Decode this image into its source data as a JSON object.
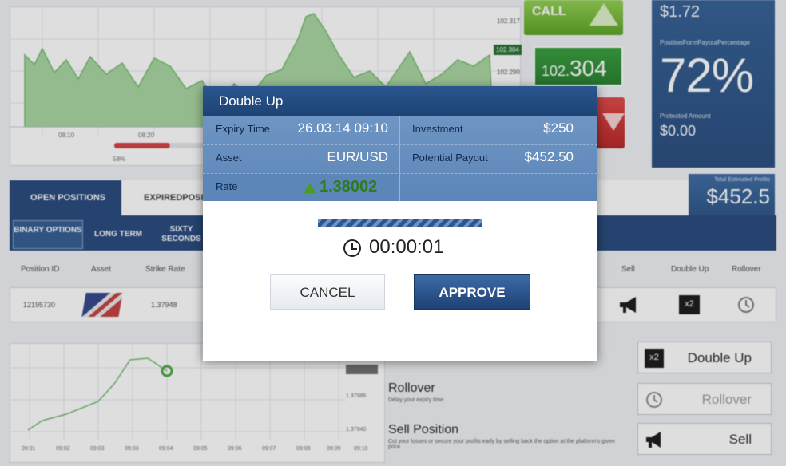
{
  "background": {
    "top_chart": {
      "x_ticks": [
        "08:10",
        "08:20"
      ],
      "progress_label": "58%",
      "progress": 0.58
    },
    "price_axis": [
      "102.317",
      "102.304",
      "102.290"
    ],
    "call_label": "CALL",
    "current_price": {
      "prefix": "102.",
      "main": "304"
    },
    "payout": {
      "top_value": "$1.72",
      "label": "PositionFormPayoutPercentage",
      "percentage": "72%",
      "protected_label": "Protected Amount",
      "protected_value": "$0.00"
    },
    "estimated": {
      "label": "Total Estimated Profits",
      "value": "$452.5"
    },
    "tabs": [
      "OPEN POSITIONS",
      "EXPIREDPOSIT"
    ],
    "subtabs": [
      "BINARY OPTIONS",
      "LONG TERM",
      "SIXTY SECONDS"
    ],
    "columns": [
      "Position ID",
      "Asset",
      "Strike Rate",
      "Sell",
      "Double Up",
      "Rollover"
    ],
    "row": {
      "position_id": "12195730",
      "strike_rate": "1.37948",
      "x2_label": "x2"
    },
    "bottom_chart": {
      "x_ticks": [
        "09:01",
        "09:02",
        "09:03",
        "09:03",
        "09:04",
        "09:05",
        "09:06",
        "09:07",
        "09:08",
        "09:09",
        "09:10"
      ],
      "y_ticks": [
        "1.38003",
        "1.37986",
        "1.37940"
      ]
    },
    "actions": {
      "rollover_title": "Rollover",
      "rollover_desc": "Delay your expiry time",
      "sell_title": "Sell Position",
      "sell_desc": "Cut your losses or secure your profits early by selling back the option at the platform's given price",
      "double_up_button": "Double Up",
      "double_up_badge": "x2",
      "rollover_button": "Rollover",
      "sell_button": "Sell"
    }
  },
  "modal": {
    "title": "Double Up",
    "expiry_label": "Expiry Time",
    "expiry_value": "26.03.14 09:10",
    "investment_label": "Investment",
    "investment_value": "$250",
    "asset_label": "Asset",
    "asset_value": "EUR/USD",
    "payout_label": "Potential Payout",
    "payout_value": "$452.50",
    "rate_label": "Rate",
    "rate_value": "1.38002",
    "timer": "00:00:01",
    "cancel_label": "CANCEL",
    "approve_label": "APPROVE"
  },
  "colors": {
    "navy": "#1e4377",
    "modal_info": "#6e95c3",
    "price_green": "#2f9b35",
    "rate_green": "#2d7a1f",
    "put_red": "#c82c2c"
  }
}
